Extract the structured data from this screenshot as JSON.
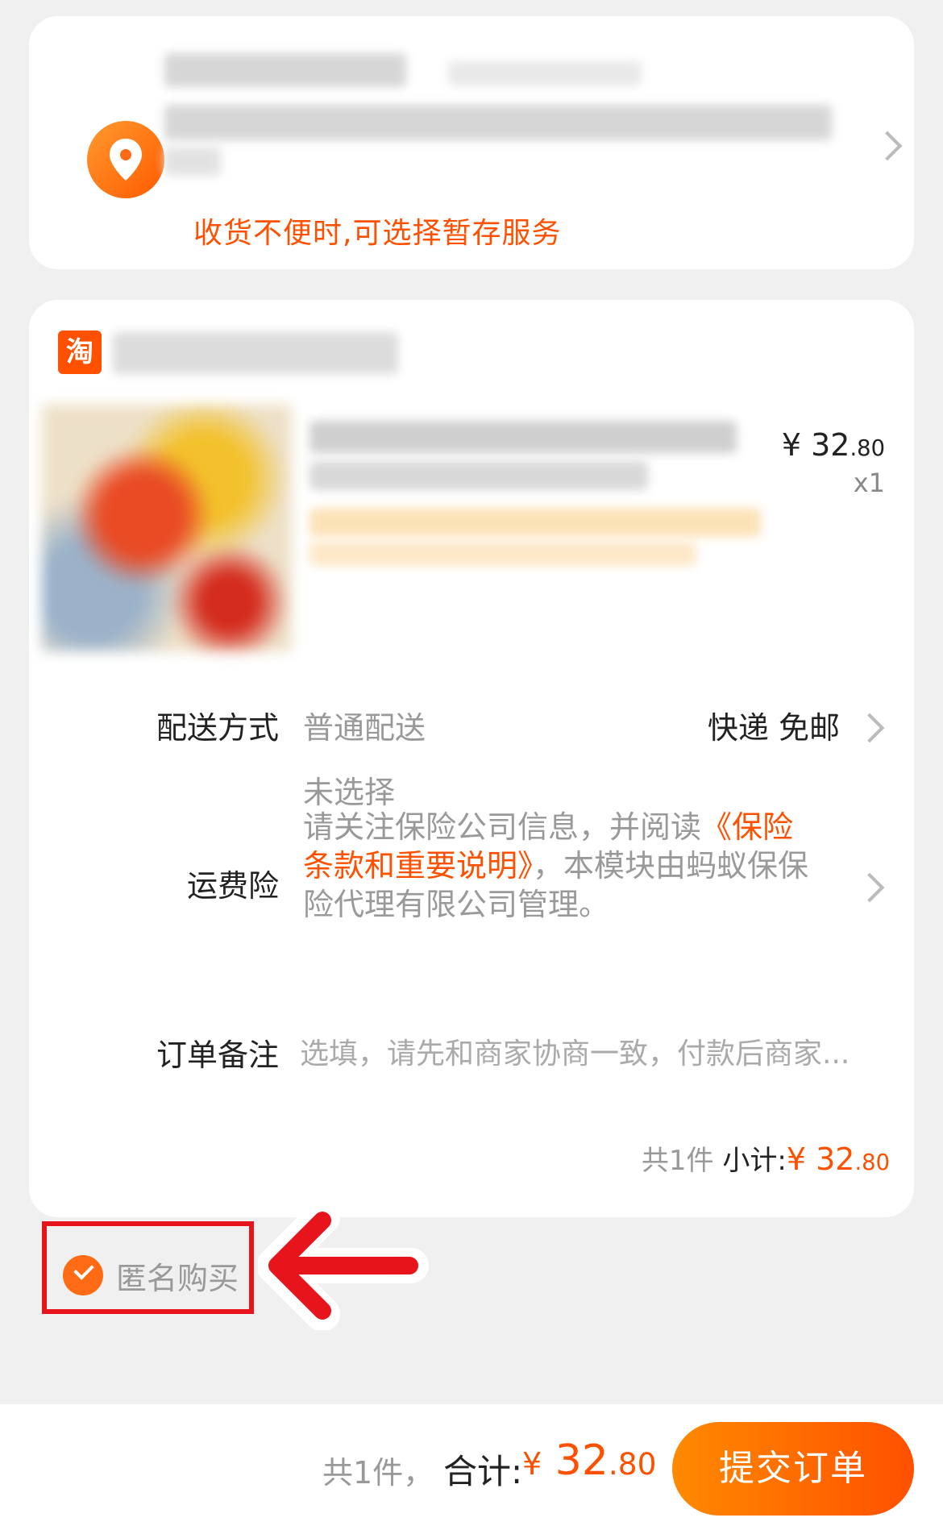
{
  "address": {
    "hint": "收货不便时,可选择暂存服务",
    "icon": "location-pin-icon"
  },
  "shop": {
    "logo_text": "淘"
  },
  "product": {
    "price_currency": "¥",
    "price_int": "32",
    "price_dec": ".80",
    "qty": "x1"
  },
  "delivery": {
    "label": "配送方式",
    "value": "普通配送",
    "right": "快递 免邮"
  },
  "insurance": {
    "label": "运费险",
    "status": "未选择",
    "text_prefix": "请关注保险公司信息，并阅读",
    "link": "《保险条款和重要说明》",
    "text_suffix": "，本模块由蚂蚁保保险代理有限公司管理。"
  },
  "note": {
    "label": "订单备注",
    "placeholder": "选填，请先和商家协商一致，付款后商家..."
  },
  "subtotal": {
    "count": "共1件",
    "label": "小计:",
    "currency": "¥",
    "int": "32",
    "dec": ".80"
  },
  "anonymous": {
    "label": "匿名购买",
    "checked": true
  },
  "bottom_bar": {
    "count": "共1件，",
    "total_label": "合计:",
    "currency": "¥",
    "int": "32",
    "dec": ".80",
    "submit_label": "提交订单"
  },
  "colors": {
    "accent": "#ff5000",
    "highlight_box": "#e8141c"
  }
}
